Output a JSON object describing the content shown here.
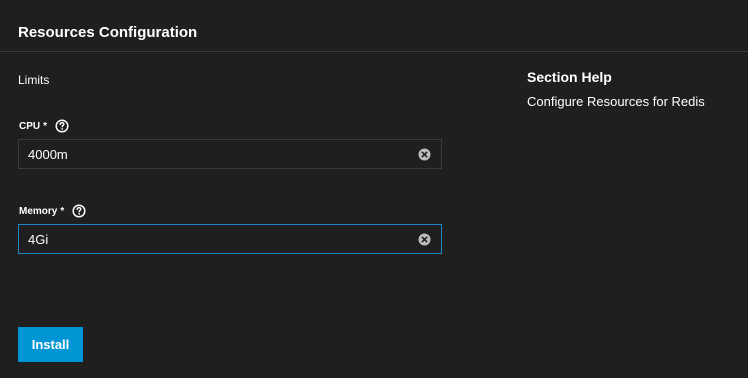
{
  "section": {
    "title": "Resources Configuration",
    "group_label": "Limits"
  },
  "fields": {
    "cpu": {
      "label": "CPU",
      "required_mark": "*",
      "value": "4000m"
    },
    "memory": {
      "label": "Memory",
      "required_mark": "*",
      "value": "4Gi"
    }
  },
  "help": {
    "title": "Section Help",
    "text": "Configure Resources for Redis"
  },
  "actions": {
    "install_label": "Install"
  },
  "icons": {
    "help": "help-circle-icon",
    "clear": "clear-circle-icon"
  },
  "colors": {
    "background": "#1f1f1f",
    "divider": "#3b3b3b",
    "accent": "#0095d5",
    "focus_border": "#1e88c8"
  }
}
